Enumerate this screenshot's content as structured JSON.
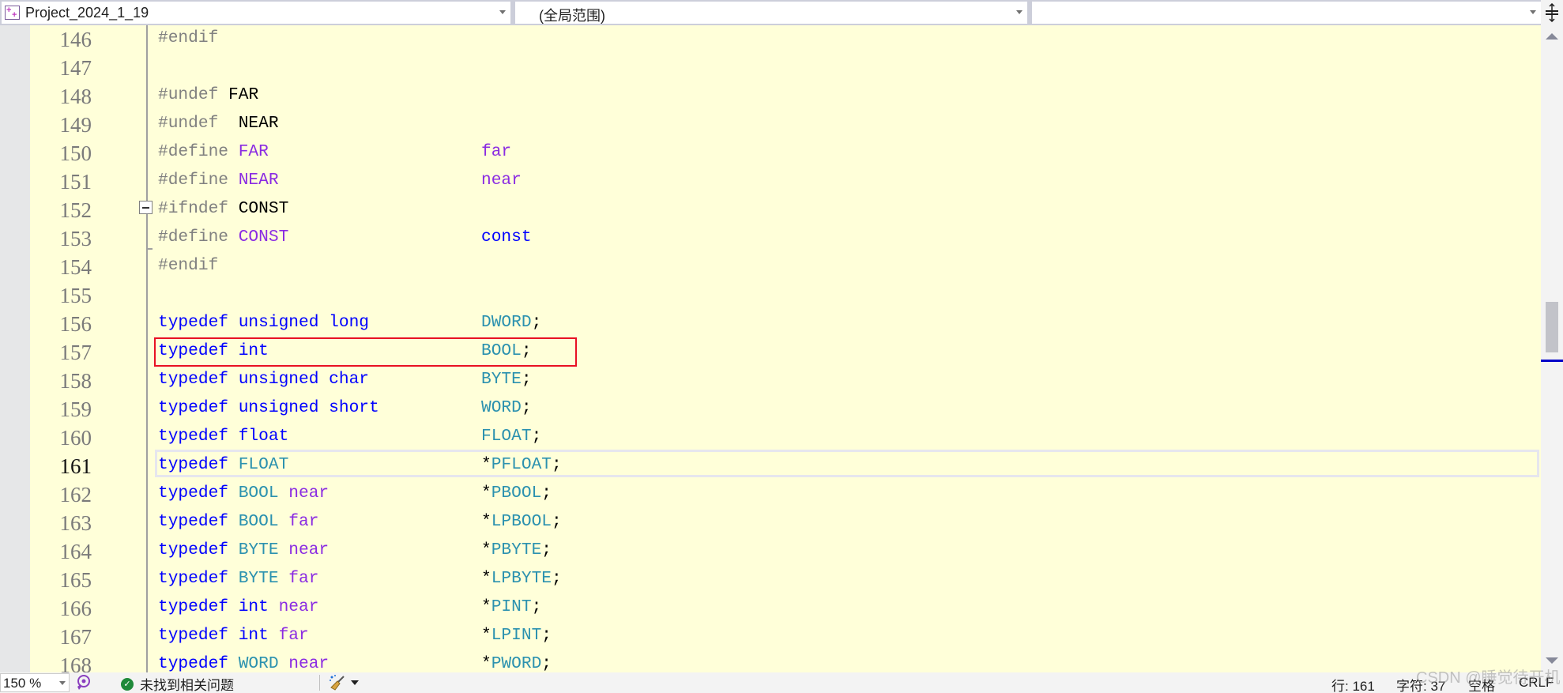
{
  "navbar": {
    "project": "Project_2024_1_19",
    "scope": "(全局范围)",
    "member": "",
    "project_icon": "project-icon",
    "split_icon": "split-window-icon"
  },
  "editor": {
    "current_line": 161,
    "lines": [
      {
        "n": "146",
        "col1": [
          {
            "t": "#endif",
            "c": "pp"
          }
        ],
        "col2": []
      },
      {
        "n": "147",
        "col1": [],
        "col2": []
      },
      {
        "n": "148",
        "col1": [
          {
            "t": "#undef ",
            "c": "pp"
          },
          {
            "t": "FAR",
            "c": "id"
          }
        ],
        "col2": []
      },
      {
        "n": "149",
        "col1": [
          {
            "t": "#undef  ",
            "c": "pp"
          },
          {
            "t": "NEAR",
            "c": "id"
          }
        ],
        "col2": []
      },
      {
        "n": "150",
        "col1": [
          {
            "t": "#define ",
            "c": "pp"
          },
          {
            "t": "FAR",
            "c": "mac"
          }
        ],
        "col2": [
          {
            "t": "far",
            "c": "mac"
          }
        ]
      },
      {
        "n": "151",
        "col1": [
          {
            "t": "#define ",
            "c": "pp"
          },
          {
            "t": "NEAR",
            "c": "mac"
          }
        ],
        "col2": [
          {
            "t": "near",
            "c": "mac"
          }
        ]
      },
      {
        "n": "152",
        "col1": [
          {
            "t": "#ifndef ",
            "c": "pp"
          },
          {
            "t": "CONST",
            "c": "id"
          }
        ],
        "col2": []
      },
      {
        "n": "153",
        "col1": [
          {
            "t": "#define ",
            "c": "pp"
          },
          {
            "t": "CONST",
            "c": "mac"
          }
        ],
        "col2": [
          {
            "t": "const",
            "c": "kw"
          }
        ]
      },
      {
        "n": "154",
        "col1": [
          {
            "t": "#endif",
            "c": "pp"
          }
        ],
        "col2": []
      },
      {
        "n": "155",
        "col1": [],
        "col2": []
      },
      {
        "n": "156",
        "col1": [
          {
            "t": "typedef unsigned long",
            "c": "kw"
          }
        ],
        "col2": [
          {
            "t": "DWORD",
            "c": "ty"
          },
          {
            "t": ";",
            "c": "pl"
          }
        ]
      },
      {
        "n": "157",
        "col1": [
          {
            "t": "typedef int",
            "c": "kw"
          }
        ],
        "col2": [
          {
            "t": "BOOL",
            "c": "ty"
          },
          {
            "t": ";",
            "c": "pl"
          }
        ]
      },
      {
        "n": "158",
        "col1": [
          {
            "t": "typedef unsigned char",
            "c": "kw"
          }
        ],
        "col2": [
          {
            "t": "BYTE",
            "c": "ty"
          },
          {
            "t": ";",
            "c": "pl"
          }
        ]
      },
      {
        "n": "159",
        "col1": [
          {
            "t": "typedef unsigned short",
            "c": "kw"
          }
        ],
        "col2": [
          {
            "t": "WORD",
            "c": "ty"
          },
          {
            "t": ";",
            "c": "pl"
          }
        ]
      },
      {
        "n": "160",
        "col1": [
          {
            "t": "typedef float",
            "c": "kw"
          }
        ],
        "col2": [
          {
            "t": "FLOAT",
            "c": "ty"
          },
          {
            "t": ";",
            "c": "pl"
          }
        ]
      },
      {
        "n": "161",
        "col1": [
          {
            "t": "typedef ",
            "c": "kw"
          },
          {
            "t": "FLOAT",
            "c": "ty"
          }
        ],
        "col2": [
          {
            "t": "*",
            "c": "pl"
          },
          {
            "t": "PFLOAT",
            "c": "ty"
          },
          {
            "t": ";",
            "c": "pl"
          }
        ]
      },
      {
        "n": "162",
        "col1": [
          {
            "t": "typedef ",
            "c": "kw"
          },
          {
            "t": "BOOL",
            "c": "ty"
          },
          {
            "t": " near",
            "c": "mac"
          }
        ],
        "col2": [
          {
            "t": "*",
            "c": "pl"
          },
          {
            "t": "PBOOL",
            "c": "ty"
          },
          {
            "t": ";",
            "c": "pl"
          }
        ]
      },
      {
        "n": "163",
        "col1": [
          {
            "t": "typedef ",
            "c": "kw"
          },
          {
            "t": "BOOL",
            "c": "ty"
          },
          {
            "t": " far",
            "c": "mac"
          }
        ],
        "col2": [
          {
            "t": "*",
            "c": "pl"
          },
          {
            "t": "LPBOOL",
            "c": "ty"
          },
          {
            "t": ";",
            "c": "pl"
          }
        ]
      },
      {
        "n": "164",
        "col1": [
          {
            "t": "typedef ",
            "c": "kw"
          },
          {
            "t": "BYTE",
            "c": "ty"
          },
          {
            "t": " near",
            "c": "mac"
          }
        ],
        "col2": [
          {
            "t": "*",
            "c": "pl"
          },
          {
            "t": "PBYTE",
            "c": "ty"
          },
          {
            "t": ";",
            "c": "pl"
          }
        ]
      },
      {
        "n": "165",
        "col1": [
          {
            "t": "typedef ",
            "c": "kw"
          },
          {
            "t": "BYTE",
            "c": "ty"
          },
          {
            "t": " far",
            "c": "mac"
          }
        ],
        "col2": [
          {
            "t": "*",
            "c": "pl"
          },
          {
            "t": "LPBYTE",
            "c": "ty"
          },
          {
            "t": ";",
            "c": "pl"
          }
        ]
      },
      {
        "n": "166",
        "col1": [
          {
            "t": "typedef int",
            "c": "kw"
          },
          {
            "t": " near",
            "c": "mac"
          }
        ],
        "col2": [
          {
            "t": "*",
            "c": "pl"
          },
          {
            "t": "PINT",
            "c": "ty"
          },
          {
            "t": ";",
            "c": "pl"
          }
        ]
      },
      {
        "n": "167",
        "col1": [
          {
            "t": "typedef int",
            "c": "kw"
          },
          {
            "t": " far",
            "c": "mac"
          }
        ],
        "col2": [
          {
            "t": "*",
            "c": "pl"
          },
          {
            "t": "LPINT",
            "c": "ty"
          },
          {
            "t": ";",
            "c": "pl"
          }
        ]
      },
      {
        "n": "168",
        "col1": [
          {
            "t": "typedef ",
            "c": "kw"
          },
          {
            "t": "WORD",
            "c": "ty"
          },
          {
            "t": " near",
            "c": "mac"
          }
        ],
        "col2": [
          {
            "t": "*",
            "c": "pl"
          },
          {
            "t": "PWORD",
            "c": "ty"
          },
          {
            "t": ";",
            "c": "pl"
          }
        ]
      }
    ],
    "highlight_box_line": 157,
    "highlight_color": "#e81123"
  },
  "statusbar": {
    "zoom": "150 %",
    "issues": "未找到相关问题",
    "line": "行: 161",
    "char": "字符: 37",
    "whitespace": "空格",
    "eol": "CRLF"
  },
  "watermark": "CSDN @睡觉待开机",
  "colors": {
    "editor_bg": "#ffffd9",
    "keyword": "#0000ff",
    "type": "#2b91af",
    "macro": "#8a2be2",
    "preprocessor": "#808080"
  }
}
